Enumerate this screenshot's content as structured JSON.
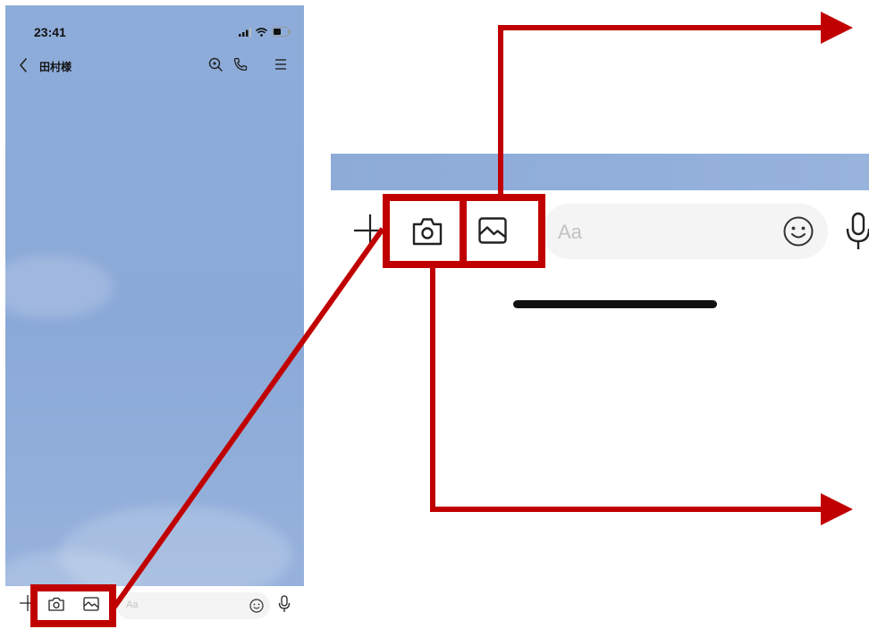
{
  "status_bar": {
    "time": "23:41"
  },
  "chat_header": {
    "title": "田村様"
  },
  "message_input": {
    "placeholder": "Aa"
  },
  "zoomed_input": {
    "placeholder": "Aa"
  },
  "icons": {
    "back": "back-chevron-icon",
    "search": "search-icon",
    "call": "phone-call-icon",
    "menu": "menu-icon",
    "plus": "plus-icon",
    "camera": "camera-icon",
    "image": "image-icon",
    "emoji": "emoji-icon",
    "mic": "microphone-icon"
  },
  "colors": {
    "chat_background": "#8dabd9",
    "annotation": "#c00000"
  }
}
